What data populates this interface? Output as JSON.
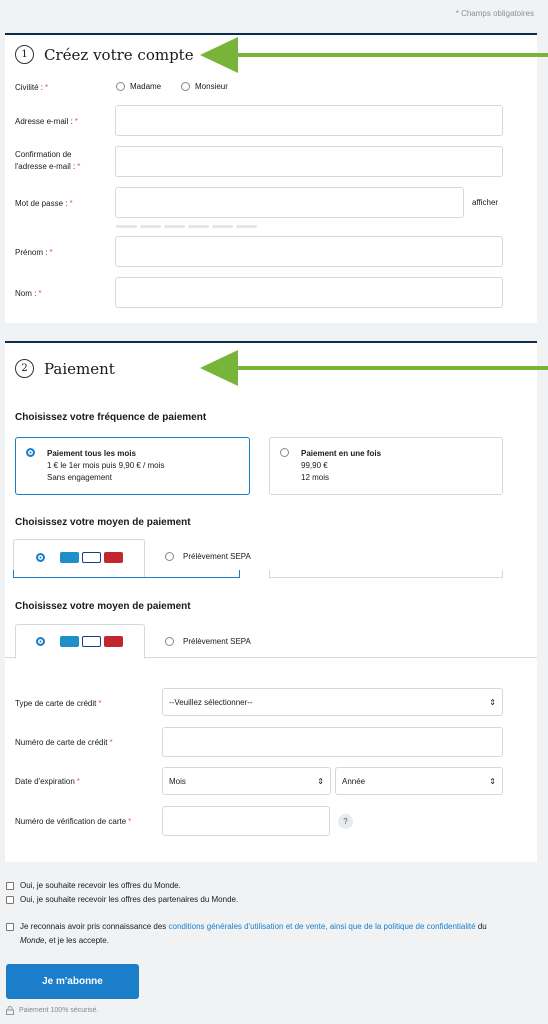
{
  "required_note": "* Champs obligatoires",
  "account": {
    "number": "1",
    "title": "Créez votre compte",
    "civility_label": "Civilité :",
    "civility_options": [
      "Madame",
      "Monsieur"
    ],
    "email_label": "Adresse e-mail :",
    "email_confirm_label_1": "Confirmation de",
    "email_confirm_label_2": "l'adresse e-mail :",
    "password_label": "Mot de passe :",
    "show_password": "afficher",
    "firstname_label": "Prénom :",
    "lastname_label": "Nom :",
    "required_mark": "*"
  },
  "payment": {
    "number": "2",
    "title": "Paiement",
    "frequency_heading": "Choisissez votre fréquence de paiement",
    "plans": [
      {
        "title": "Paiement tous les mois",
        "line1": "1 € le 1er mois puis 9,90 € / mois",
        "line2": "Sans engagement",
        "selected": true
      },
      {
        "title": "Paiement en une fois",
        "line1": "99,90 €",
        "line2": "12 mois",
        "selected": false
      }
    ],
    "method_heading": "Choisissez votre moyen de paiement",
    "sepa_label": "Prélèvement SEPA",
    "card_type_label": "Type de carte de crédit",
    "card_type_value": "--Veuillez sélectionner--",
    "card_number_label": "Numéro de carte de crédit",
    "expiry_label": "Date d'expiration",
    "month_value": "Mois",
    "year_value": "Année",
    "cvv_label": "Numéro de vérification de carte",
    "cvv_help": "?"
  },
  "consents": {
    "offers_monde": "Oui, je souhaite recevoir les offres du Monde.",
    "offers_partners": "Oui, je souhaite recevoir les offres des partenaires du Monde.",
    "terms_prefix": "Je reconnais avoir pris connaissance des ",
    "terms_link": "conditions générales d'utilisation et de vente, ainsi que de la politique de confidentialité",
    "terms_middle": " du ",
    "terms_brand": "Monde",
    "terms_suffix": ", et je les accepte."
  },
  "submit_label": "Je m'abonne",
  "secure_note": "Paiement 100% sécurisé.",
  "colors": {
    "accent": "#1a7ecb",
    "navy": "#0b2c4f",
    "arrow": "#78b43a",
    "required": "#e05a5a"
  }
}
